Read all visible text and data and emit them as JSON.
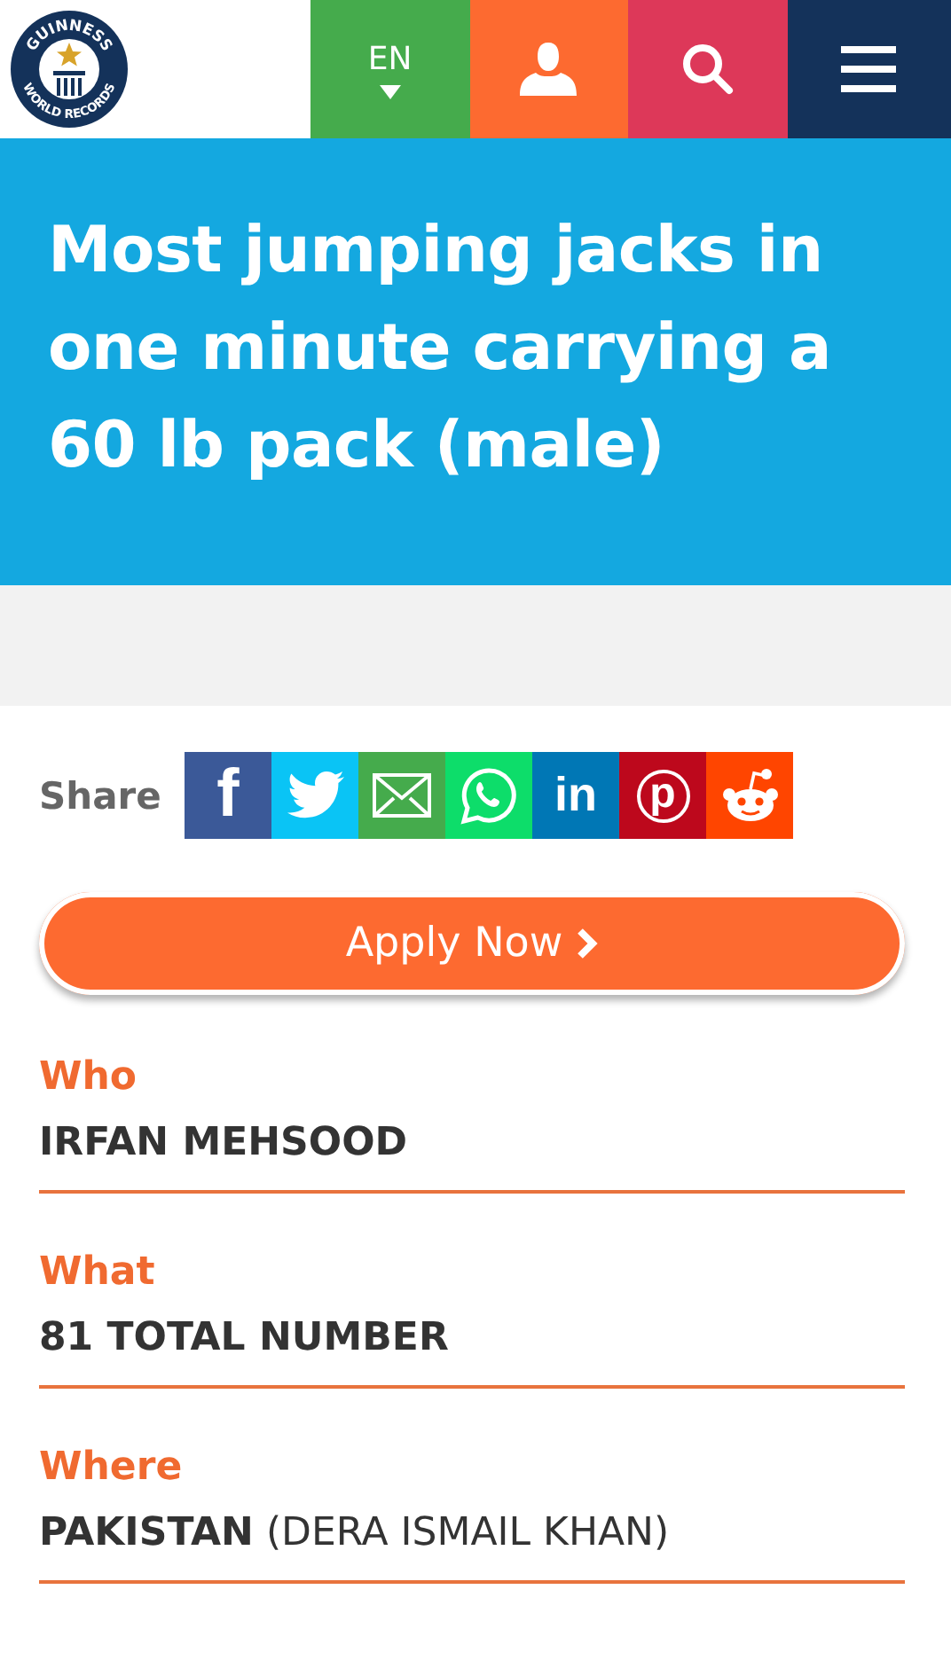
{
  "header": {
    "logo": {
      "top_text": "GUINNESS",
      "bottom_text": "WORLD RECORDS"
    },
    "nav": [
      {
        "kind": "language",
        "label": "EN"
      },
      {
        "kind": "account"
      },
      {
        "kind": "search"
      },
      {
        "kind": "menu"
      }
    ]
  },
  "title": "Most jumping jacks in one minute carrying a 60 lb pack (male)",
  "share": {
    "label": "Share",
    "buttons": [
      {
        "kind": "facebook",
        "glyph": "f"
      },
      {
        "kind": "twitter"
      },
      {
        "kind": "email"
      },
      {
        "kind": "whatsapp"
      },
      {
        "kind": "linkedin",
        "glyph": "in"
      },
      {
        "kind": "pinterest",
        "glyph": "p"
      },
      {
        "kind": "reddit"
      }
    ]
  },
  "apply_button": "Apply Now",
  "fields": [
    {
      "label": "Who",
      "value": "IRFAN MEHSOOD"
    },
    {
      "label": "What",
      "value": "81 TOTAL NUMBER"
    },
    {
      "label": "Where",
      "value": "**PAKISTAN** (DERA ISMAIL KHAN)"
    }
  ]
}
